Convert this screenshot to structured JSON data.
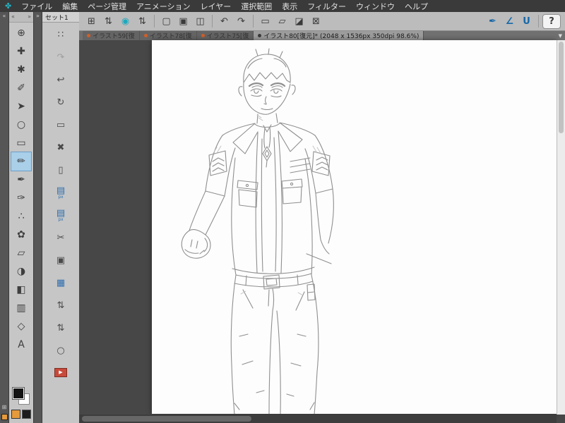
{
  "app": {
    "logo_glyph": "✤"
  },
  "menubar": {
    "items": [
      "ファイル",
      "編集",
      "ページ管理",
      "アニメーション",
      "レイヤー",
      "選択範囲",
      "表示",
      "フィルター",
      "ウィンドウ",
      "ヘルプ"
    ]
  },
  "toolbar": {
    "items": [
      {
        "name": "grid-view",
        "glyph": "⊞"
      },
      {
        "name": "stepper-a",
        "glyph": "⇅"
      },
      {
        "name": "clip-spiral",
        "glyph": "◉"
      },
      {
        "name": "stepper-b",
        "glyph": "⇅"
      },
      {
        "name": "new-page",
        "glyph": "▢"
      },
      {
        "name": "open-page",
        "glyph": "▣"
      },
      {
        "name": "save",
        "glyph": "◫"
      },
      {
        "name": "undo",
        "glyph": "↶"
      },
      {
        "name": "redo",
        "glyph": "↷"
      },
      {
        "name": "select-area",
        "glyph": "▭"
      },
      {
        "name": "deselect",
        "glyph": "▱"
      },
      {
        "name": "erase",
        "glyph": "◪"
      },
      {
        "name": "transform",
        "glyph": "⊠"
      }
    ],
    "right_items": [
      {
        "name": "snap-pen",
        "glyph": "✒"
      },
      {
        "name": "snap-ruler",
        "glyph": "∠"
      },
      {
        "name": "snap-special",
        "glyph": "U"
      },
      {
        "name": "help",
        "glyph": "?"
      }
    ]
  },
  "tabbar": {
    "tabs": [
      {
        "label": "イラスト59[復",
        "active": false
      },
      {
        "label": "イラスト78[復",
        "active": false
      },
      {
        "label": "イラスト75[復",
        "active": false
      },
      {
        "label": "イラスト80[復元]* (2048 x 1536px 350dpi 98.6%)",
        "active": true
      }
    ],
    "overflow_glyph": "▼"
  },
  "dock": {
    "edge_collapse_glyph": "«",
    "edge_bottom_glyph": "⊞",
    "mini_collapse_glyph": "»",
    "tools_header": {
      "left_glyph": "«",
      "right_glyph": "»"
    },
    "tools": [
      {
        "name": "zoom",
        "glyph": "⊕"
      },
      {
        "name": "move",
        "glyph": "✚"
      },
      {
        "name": "hand",
        "glyph": "✱"
      },
      {
        "name": "eyedropper",
        "glyph": "✐"
      },
      {
        "name": "operation",
        "glyph": "➤"
      },
      {
        "name": "lasso",
        "glyph": "○"
      },
      {
        "name": "selection",
        "glyph": "▭"
      },
      {
        "name": "pencil",
        "glyph": "✏",
        "selected": true
      },
      {
        "name": "pen",
        "glyph": "✒"
      },
      {
        "name": "brush",
        "glyph": "✑"
      },
      {
        "name": "airbrush",
        "glyph": "∴"
      },
      {
        "name": "decoration",
        "glyph": "✿"
      },
      {
        "name": "eraser",
        "glyph": "▱"
      },
      {
        "name": "blend",
        "glyph": "◑"
      },
      {
        "name": "fill",
        "glyph": "◧"
      },
      {
        "name": "gradient",
        "glyph": "▥"
      },
      {
        "name": "figure",
        "glyph": "◇"
      },
      {
        "name": "text",
        "glyph": "A"
      }
    ],
    "subtools_tab": "セット1",
    "subtools": [
      {
        "name": "spray-pattern",
        "glyph": "∷"
      },
      {
        "name": "redo",
        "glyph": "↷"
      },
      {
        "name": "undo",
        "glyph": "↩"
      },
      {
        "name": "rotate",
        "glyph": "↻"
      },
      {
        "name": "frame",
        "glyph": "▭"
      },
      {
        "name": "close",
        "glyph": "✖"
      },
      {
        "name": "paper",
        "glyph": "▯"
      },
      {
        "name": "png-file-1",
        "glyph": "▤",
        "label": "px"
      },
      {
        "name": "png-file-2",
        "glyph": "▤",
        "label": "px"
      },
      {
        "name": "scissors",
        "glyph": "✂"
      },
      {
        "name": "clipboard",
        "glyph": "▣"
      },
      {
        "name": "layers",
        "glyph": "▦"
      },
      {
        "name": "stepper-1",
        "glyph": "⇅"
      },
      {
        "name": "stepper-2",
        "glyph": "⇅"
      },
      {
        "name": "circle",
        "glyph": "○"
      },
      {
        "name": "record",
        "glyph": "▶"
      }
    ],
    "color_chips": {
      "main": "#141414",
      "sub": "#ffffff",
      "accent": "#e59a3c",
      "dark": "#1c1c1c"
    }
  },
  "canvas": {
    "description": "Rough pencil sketch of a young man with short hair wearing a short-sleeved uniform shirt with sleeve rank patches, chest pockets, necklace pendant, belt and trousers; left fist extended, right hand at pocket."
  }
}
